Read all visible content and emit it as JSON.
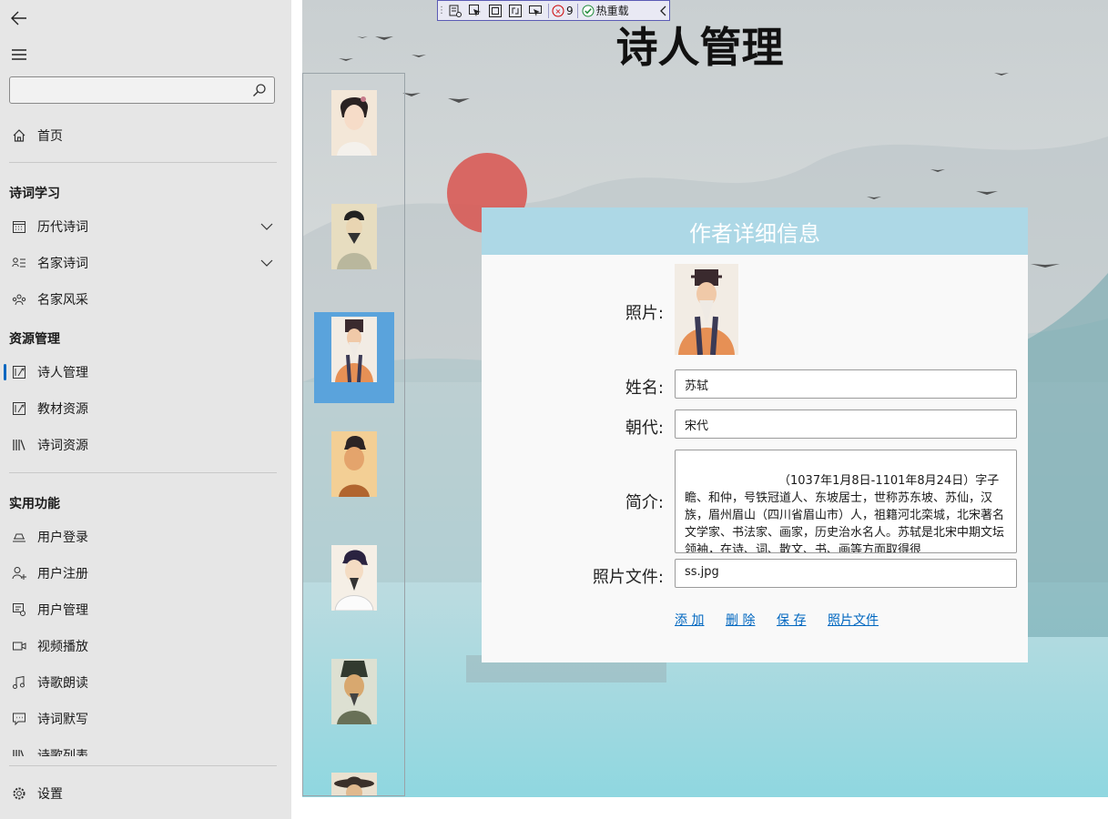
{
  "nav": {
    "search_placeholder": "",
    "home": "首页",
    "sections": [
      {
        "title": "诗词学习"
      },
      {
        "title": "资源管理"
      },
      {
        "title": "实用功能"
      }
    ],
    "items": [
      {
        "label": "历代诗词",
        "icon": "calendar-icon"
      },
      {
        "label": "名家诗词",
        "icon": "contact-list-icon"
      },
      {
        "label": "名家风采",
        "icon": "people-icon"
      },
      {
        "label": "诗人管理",
        "icon": "edit-document-icon",
        "selected": true
      },
      {
        "label": "教材资源",
        "icon": "edit-document-icon"
      },
      {
        "label": "诗词资源",
        "icon": "library-icon"
      },
      {
        "label": "用户登录",
        "icon": "login-icon"
      },
      {
        "label": "用户注册",
        "icon": "add-user-icon"
      },
      {
        "label": "用户管理",
        "icon": "manage-users-icon"
      },
      {
        "label": "视频播放",
        "icon": "video-icon"
      },
      {
        "label": "诗歌朗读",
        "icon": "music-note-icon"
      },
      {
        "label": "诗词默写",
        "icon": "message-icon"
      },
      {
        "label": "诗歌列表",
        "icon": "library-icon"
      }
    ],
    "settings": "设置"
  },
  "debug_toolbar": {
    "count": "9",
    "hot_reload": "热重载"
  },
  "page": {
    "title": "诗人管理"
  },
  "poet_list": {
    "selected_index": 2,
    "count_visible": 7
  },
  "card": {
    "header": "作者详细信息",
    "photo_label": "照片:",
    "name_label": "姓名:",
    "name_value": "苏轼",
    "dynasty_label": "朝代:",
    "dynasty_value": "宋代",
    "intro_label": "简介:",
    "intro_value": "（1037年1月8日-1101年8月24日）字子瞻、和仲，号铁冠道人、东坡居士，世称苏东坡、苏仙，汉族，眉州眉山（四川省眉山市）人，祖籍河北栾城，北宋著名文学家、书法家、画家，历史治水名人。苏轼是北宋中期文坛领袖，在诗、词、散文、书、画等方面取得很",
    "file_label": "照片文件:",
    "file_value": "ss.jpg",
    "actions": [
      "添 加",
      "删 除",
      "保 存",
      "照片文件"
    ]
  },
  "colors": {
    "accent": "#0067c0",
    "card_header": "#add8e6",
    "selected_thumb": "#5aa3dc"
  }
}
